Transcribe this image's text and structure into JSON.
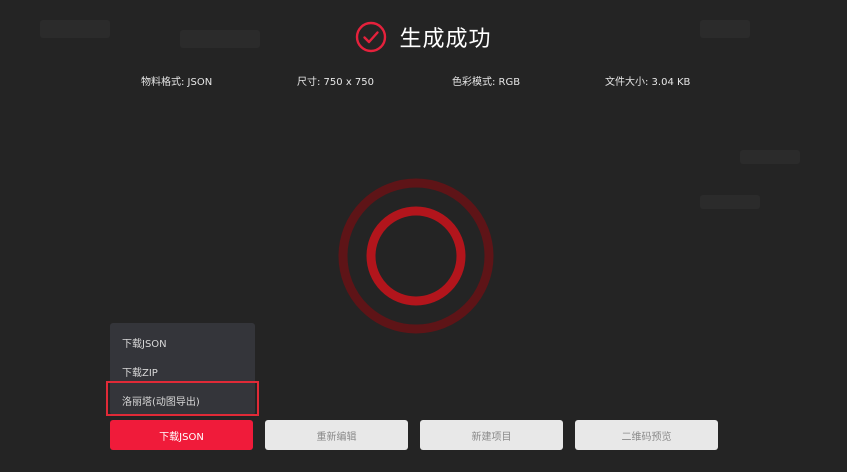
{
  "header": {
    "title": "生成成功",
    "status_icon": "check-circle-icon",
    "accent_color": "#e5213c"
  },
  "meta": {
    "format": "物料格式: JSON",
    "size": "尺寸: 750 x 750",
    "color_mode": "色彩模式: RGB",
    "file_size": "文件大小: 3.04 KB"
  },
  "loader": {
    "icon": "loading-rings-icon",
    "color": "#b2151c"
  },
  "download_menu": {
    "items": [
      {
        "label": "下载JSON"
      },
      {
        "label": "下载ZIP"
      },
      {
        "label": "洛丽塔(动图导出)"
      }
    ],
    "highlight_color": "#e02a37"
  },
  "actions": {
    "download_json": "下载JSON",
    "re_edit": "重新编辑",
    "new_project": "新建项目",
    "qr_preview": "二维码预览"
  }
}
